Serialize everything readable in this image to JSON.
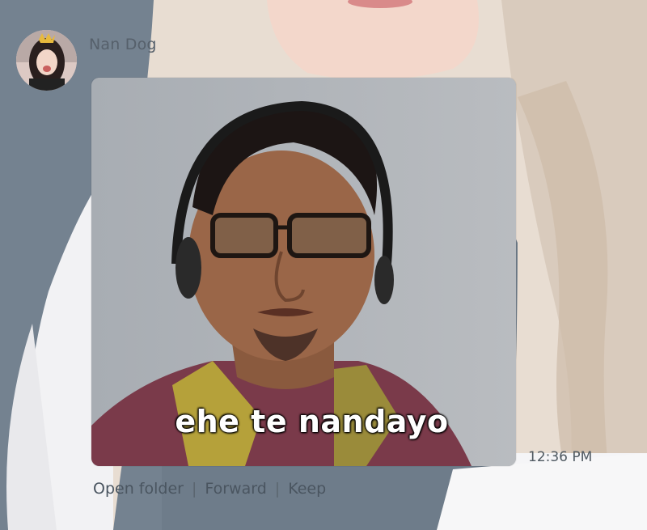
{
  "message": {
    "sender_name": "Nan Dog",
    "caption": "ehe te nandayo",
    "timestamp": "12:36 PM"
  },
  "actions": {
    "open_folder": "Open folder",
    "forward": "Forward",
    "keep": "Keep",
    "separator": "|"
  },
  "colors": {
    "sender_text": "#56606b",
    "action_text": "#4a5560",
    "caption_text": "#ffffff"
  }
}
